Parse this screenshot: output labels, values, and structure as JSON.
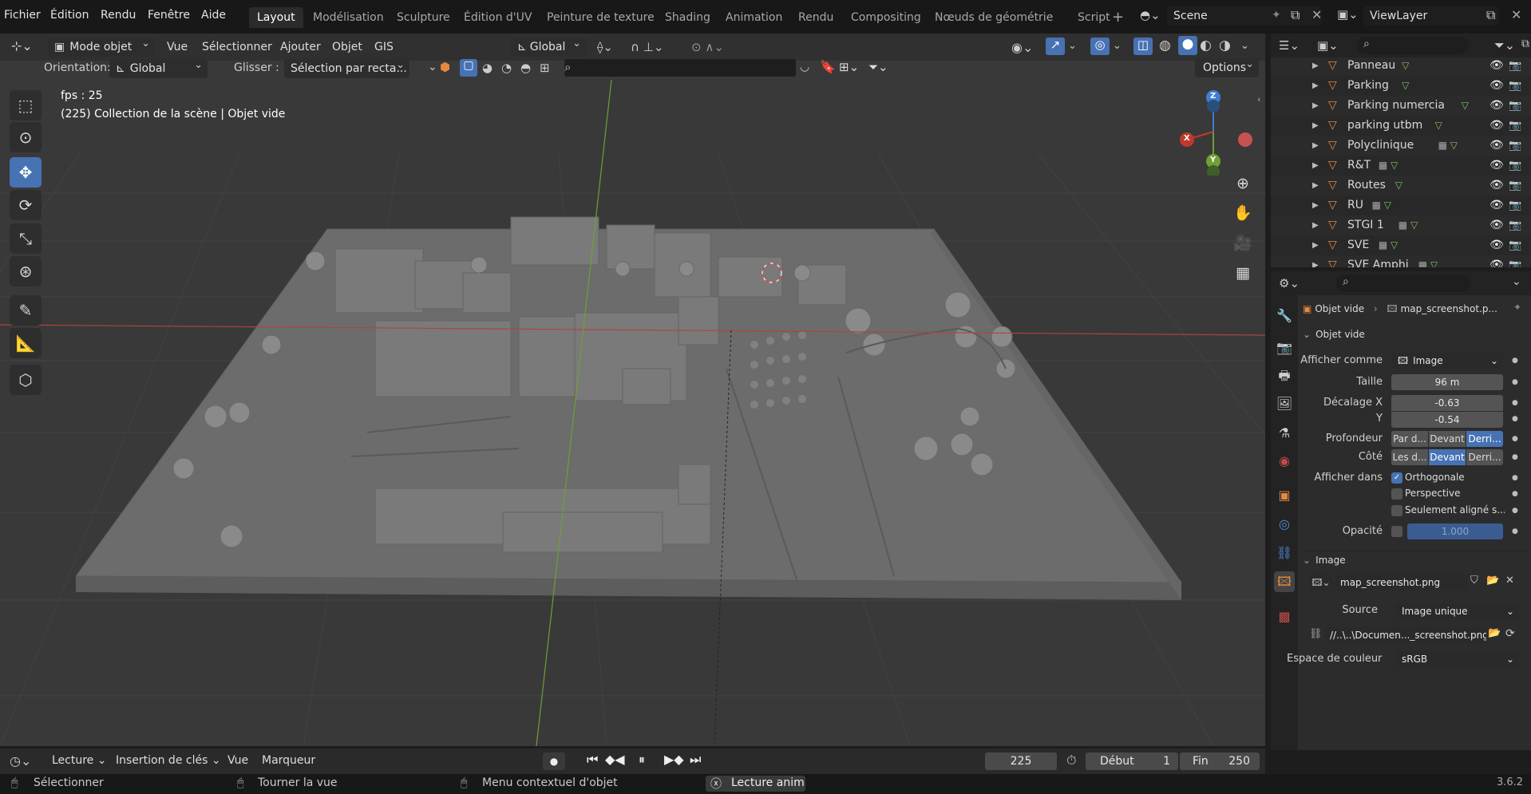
{
  "menu": [
    "Fichier",
    "Édition",
    "Rendu",
    "Fenêtre",
    "Aide"
  ],
  "workspace_tabs": [
    "Layout",
    "Modélisation",
    "Sculpture",
    "Édition d'UV",
    "Peinture de texture",
    "Shading",
    "Animation",
    "Rendu",
    "Compositing",
    "Nœuds de géométrie",
    "Script"
  ],
  "add_tab": "+",
  "scene_name": "Scene",
  "view_layer": "ViewLayer",
  "header": {
    "mode": "Mode objet",
    "vue": "Vue",
    "selectionner": "Sélectionner",
    "ajouter": "Ajouter",
    "objet": "Objet",
    "gis": "GIS",
    "transform_global": "Global",
    "orientation_label": "Orientation:",
    "orientation_value": "Global",
    "glisser_label": "Glisser :",
    "glisser_value": "Sélection par recta...",
    "options": "Options"
  },
  "overlay": {
    "fps": "fps : 25",
    "collection": "(225) Collection de la scène | Objet vide"
  },
  "gizmo": {
    "x": "X",
    "y": "Y",
    "z": "Z"
  },
  "outliner": {
    "rows": [
      "Panneau",
      "Parking",
      "Parking numercia",
      "parking utbm",
      "Polyclinique",
      "R&T",
      "Routes",
      "RU",
      "STGI 1",
      "SVE",
      "SVE Amphi"
    ]
  },
  "props": {
    "breadcrumb_obj": "Objet vide",
    "breadcrumb_img": "map_screenshot.p...",
    "panel_title": "Objet vide",
    "afficher_comme_label": "Afficher comme",
    "afficher_comme": "Image",
    "taille_label": "Taille",
    "taille": "96 m",
    "decalage_x_label": "Décalage X",
    "decalage_x": "-0.63",
    "y_label": "Y",
    "decalage_y": "-0.54",
    "profondeur_label": "Profondeur",
    "profondeur": [
      "Par d...",
      "Devant",
      "Derri..."
    ],
    "cote_label": "Côté",
    "cote": [
      "Les d...",
      "Devant",
      "Derri..."
    ],
    "afficher_dans_label": "Afficher dans",
    "orthogonale": "Orthogonale",
    "perspective": "Perspective",
    "seulement": "Seulement aligné s...",
    "opacite_label": "Opacité",
    "opacite": "1.000",
    "image_section": "Image",
    "image_name": "map_screenshot.png",
    "source_label": "Source",
    "source": "Image unique",
    "filepath": "//..\\..\\Documen..._screenshot.png",
    "espace_label": "Espace de couleur",
    "espace": "sRGB"
  },
  "timeline": {
    "lecture": "Lecture",
    "insertion": "Insertion de clés",
    "vue": "Vue",
    "marqueur": "Marqueur",
    "current_frame": "225",
    "debut_label": "Début",
    "debut": "1",
    "fin_label": "Fin",
    "fin": "250"
  },
  "status": {
    "select": "Sélectionner",
    "rotate": "Tourner la vue",
    "context": "Menu contextuel d'objet",
    "anim": "Lecture anim",
    "version": "3.6.2"
  },
  "colors": {
    "accent": "#4772b3",
    "viewport": "#393939",
    "x_axis": "#c0392b",
    "y_axis": "#7aa33a",
    "z_axis": "#3f7fd1",
    "collection_icon": "#e5893f"
  }
}
